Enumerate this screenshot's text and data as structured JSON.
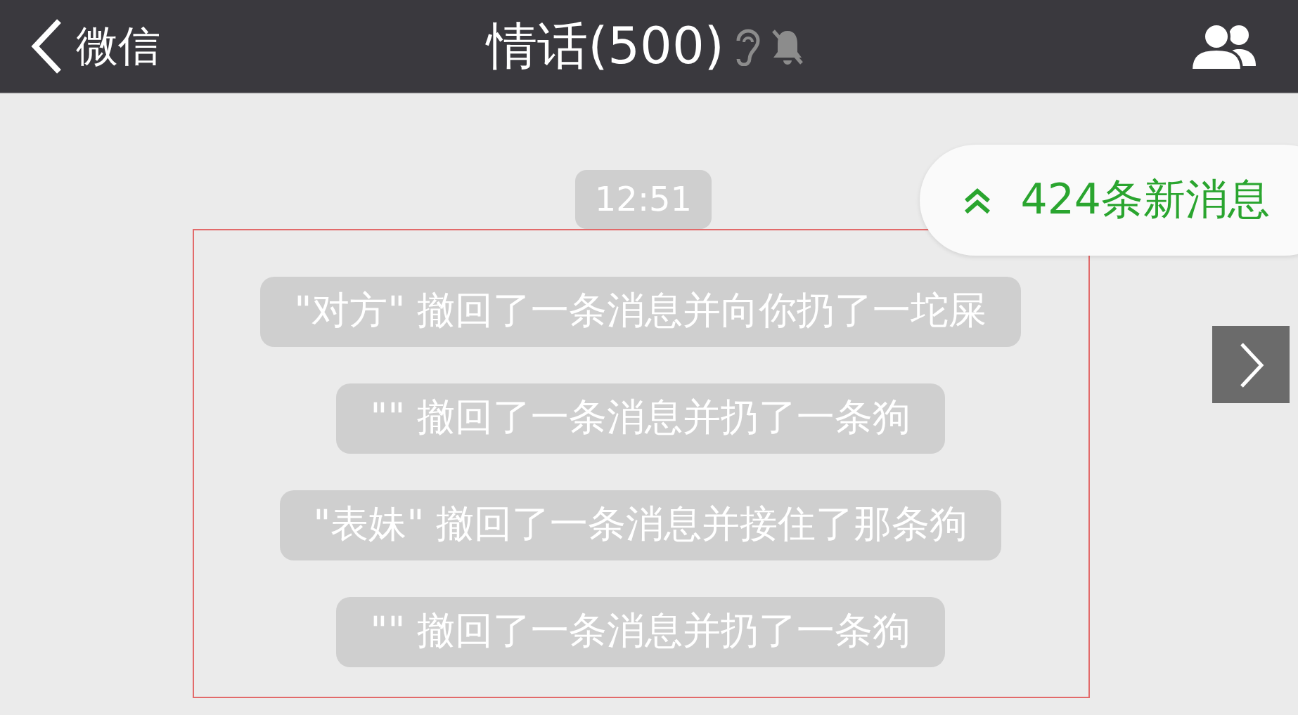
{
  "nav_bar": {
    "back_label": "微信",
    "title": "情话(500)"
  },
  "time_stamp": "12:51",
  "new_messages_badge": {
    "label": "424条新消息"
  },
  "highlighted_notices": [
    "\"对方\" 撤回了一条消息并向你扔了一坨屎",
    "\"\" 撤回了一条消息并扔了一条狗",
    "\"表妹\" 撤回了一条消息并接住了那条狗",
    "\"\" 撤回了一条消息并扔了一条狗"
  ]
}
